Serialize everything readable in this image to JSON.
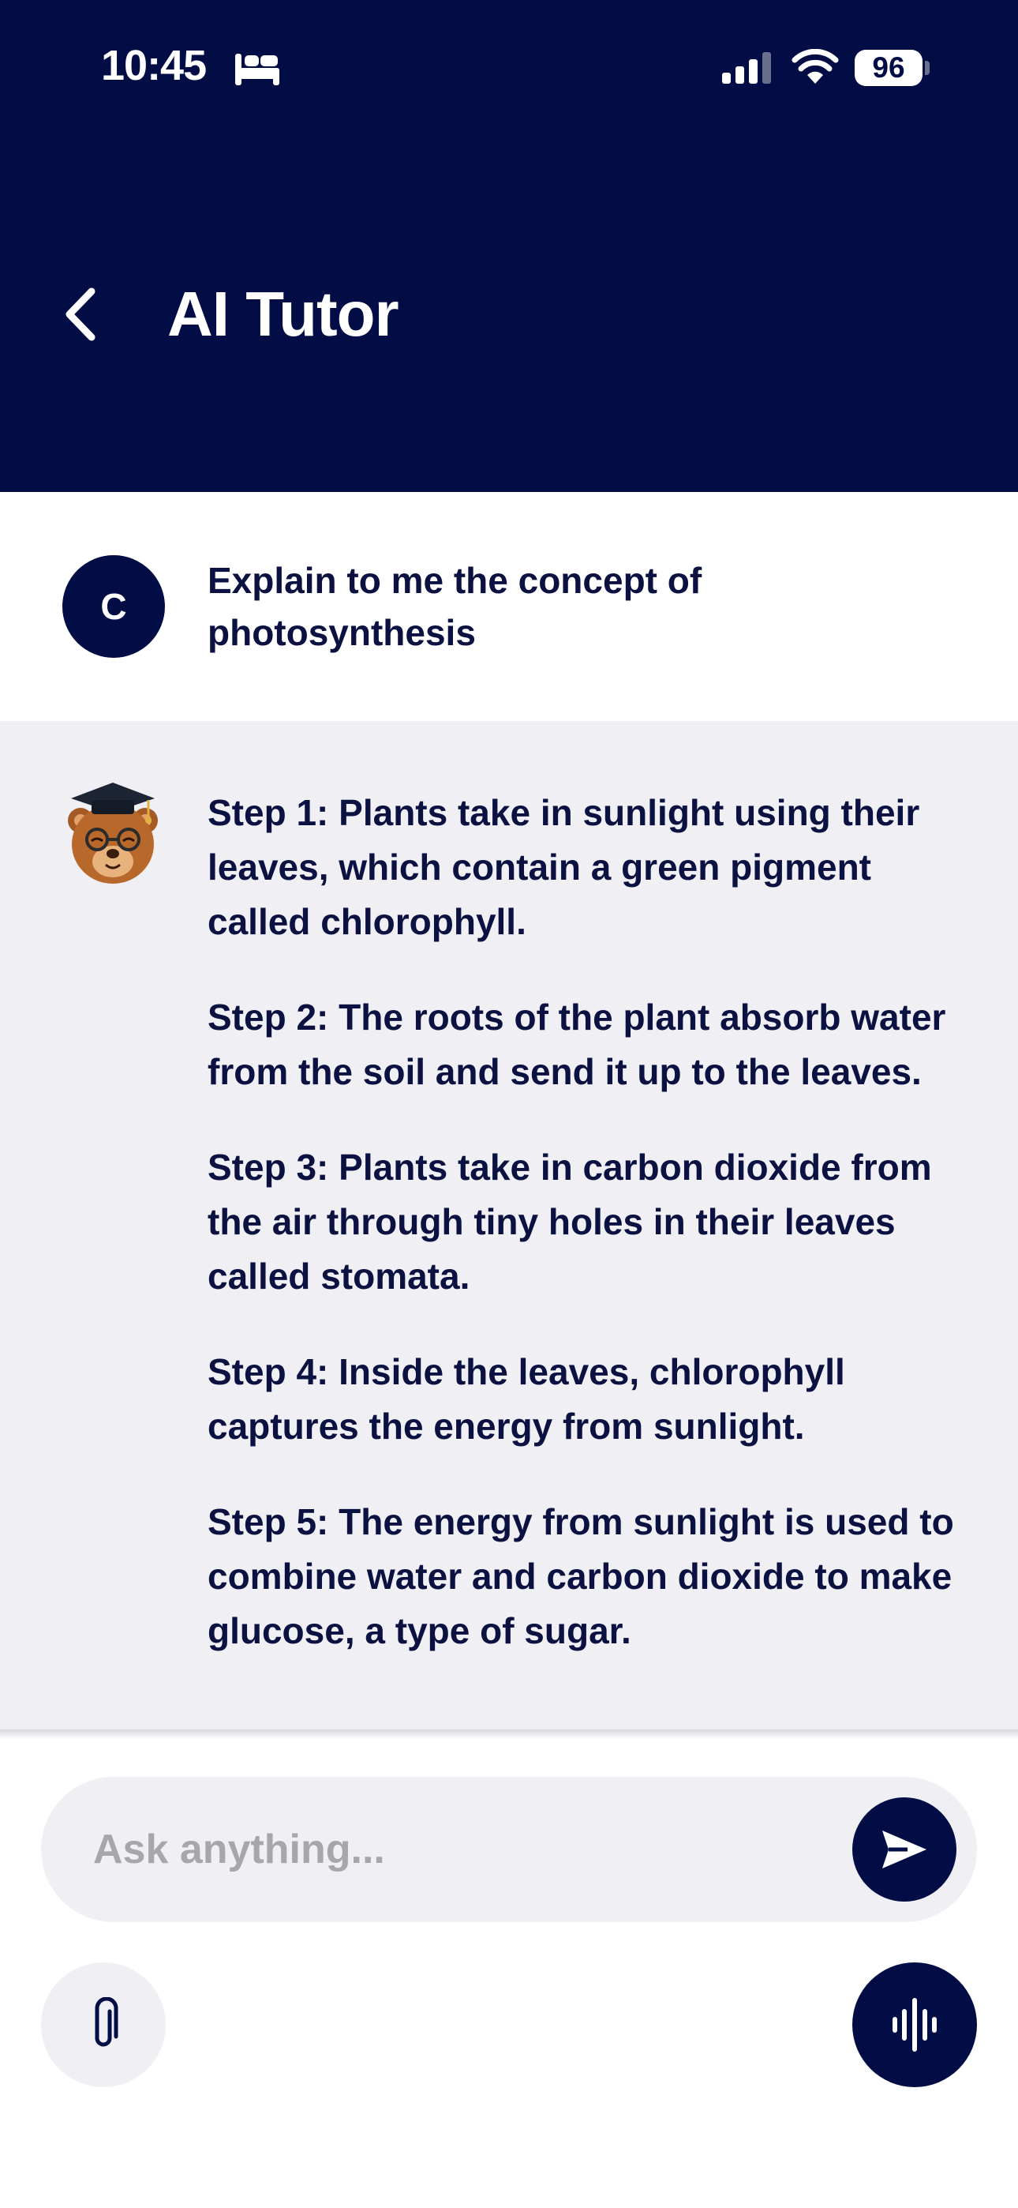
{
  "status_bar": {
    "time": "10:45",
    "battery": "96"
  },
  "header": {
    "title": "AI Tutor",
    "back_icon": "chevron-left-icon"
  },
  "conversation": {
    "user": {
      "avatar_initial": "C",
      "message": "Explain to me the concept of photosynthesis"
    },
    "assistant": {
      "avatar_icon": "bear-graduate-icon",
      "steps": [
        "Step 1: Plants take in sunlight using their leaves, which contain a green pigment called chlorophyll.",
        "Step 2: The roots of the plant absorb water from the soil and send it up to the leaves.",
        "Step 3: Plants take in carbon dioxide from the air through tiny holes in their leaves called stomata.",
        "Step 4: Inside the leaves, chlorophyll captures the energy from sunlight.",
        "Step 5: The energy from sunlight is used to combine water and carbon dioxide to make glucose, a type of sugar."
      ]
    }
  },
  "composer": {
    "placeholder": "Ask anything...",
    "send_icon": "send-icon",
    "attach_icon": "paperclip-icon",
    "voice_icon": "voice-waveform-icon"
  },
  "colors": {
    "primary": "#020d45",
    "surface": "#efeff4",
    "text": "#0b1140",
    "placeholder": "#a6a6ab"
  }
}
